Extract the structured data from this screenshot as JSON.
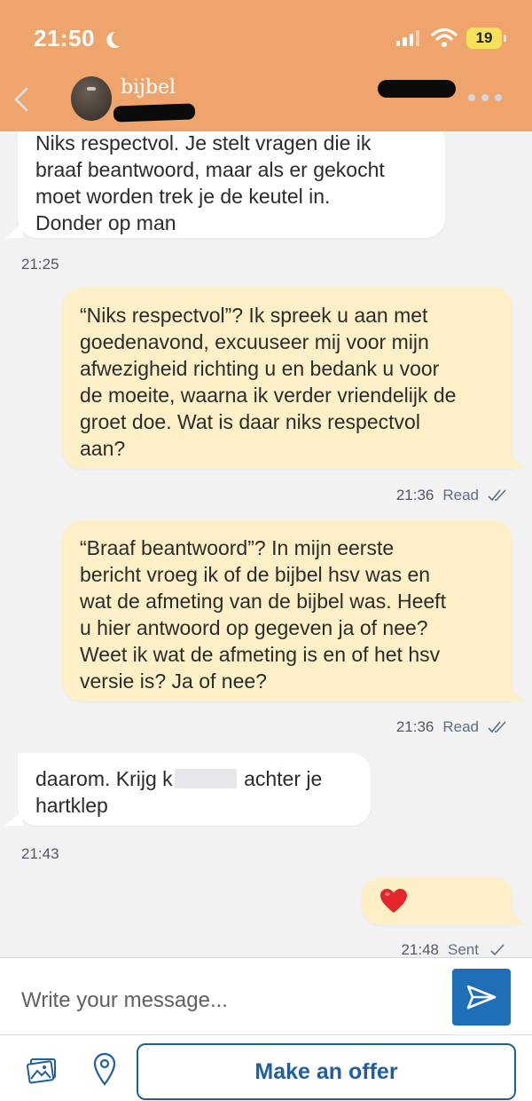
{
  "status_bar": {
    "time": "21:50",
    "battery": "19"
  },
  "header": {
    "contact_name": "bijbel"
  },
  "messages": [
    {
      "direction": "in",
      "lines": [
        "Niks respectvol. Je stelt vragen die ik",
        "braaf beantwoord, maar als er gekocht",
        "moet worden trek je de keutel in.",
        "Donder op man"
      ],
      "time": "21:25"
    },
    {
      "direction": "out",
      "lines": [
        "“Niks respectvol”? Ik spreek u aan met",
        "goedenavond, excuuseer mij voor mijn",
        "afwezigheid richting u en bedank u voor",
        "de moeite, waarna ik verder vriendelijk de",
        "groet doe. Wat is daar niks respectvol",
        "aan?"
      ],
      "time": "21:36",
      "status": "Read"
    },
    {
      "direction": "out",
      "lines": [
        "“Braaf beantwoord”? In mijn eerste",
        "bericht vroeg ik of de bijbel hsv was en",
        "wat de afmeting van de bijbel was. Heeft",
        "u hier antwoord op gegeven ja of nee?",
        "Weet ik wat de afmeting is en of het hsv",
        "versie is? Ja of nee?"
      ],
      "time": "21:36",
      "status": "Read"
    },
    {
      "direction": "in",
      "line1_start": "daarom. Krijg k",
      "line1_end": "achter je",
      "line2": "hartklep",
      "time": "21:43"
    },
    {
      "direction": "out",
      "emoji": "heart",
      "time": "21:48",
      "status": "Sent"
    }
  ],
  "compose": {
    "placeholder": "Write your message...",
    "offer_label": "Make an offer"
  },
  "colors": {
    "header_bg": "#eea46a",
    "outgoing_bubble": "#fdf0c6",
    "incoming_bubble": "#ffffff",
    "accent_blue": "#1e6fb8"
  }
}
